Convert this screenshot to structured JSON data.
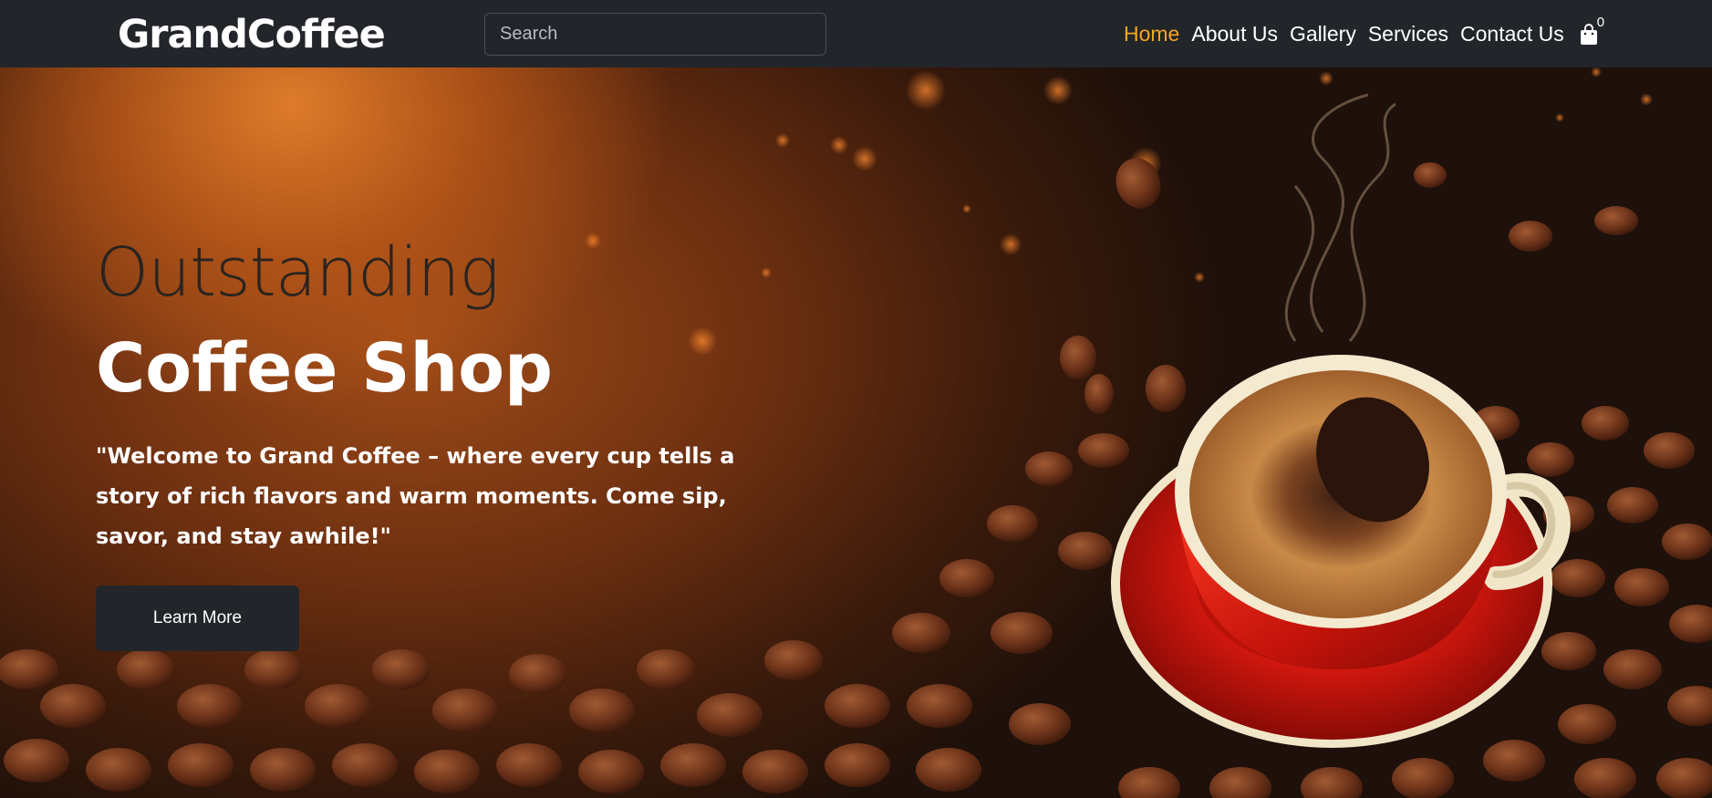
{
  "navbar": {
    "brand": "GrandCoffee",
    "search_placeholder": "Search",
    "links": [
      {
        "label": "Home",
        "active": true
      },
      {
        "label": "About Us",
        "active": false
      },
      {
        "label": "Gallery",
        "active": false
      },
      {
        "label": "Services",
        "active": false
      },
      {
        "label": "Contact Us",
        "active": false
      }
    ],
    "cart_icon": "shopping-bag-icon",
    "cart_count": "0"
  },
  "hero": {
    "title_light": "Outstanding",
    "title_bold": "Coffee Shop",
    "text": "\"Welcome to Grand Coffee – where every cup tells a story of rich flavors and warm moments. Come sip, savor, and stay awhile!\"",
    "button_label": "Learn More",
    "image": "coffee-cup-with-beans-image"
  },
  "colors": {
    "navbar_bg": "#22252a",
    "active_link": "#f5a623",
    "hero_accent": "#c1561c",
    "cup_red": "#d0170e"
  }
}
